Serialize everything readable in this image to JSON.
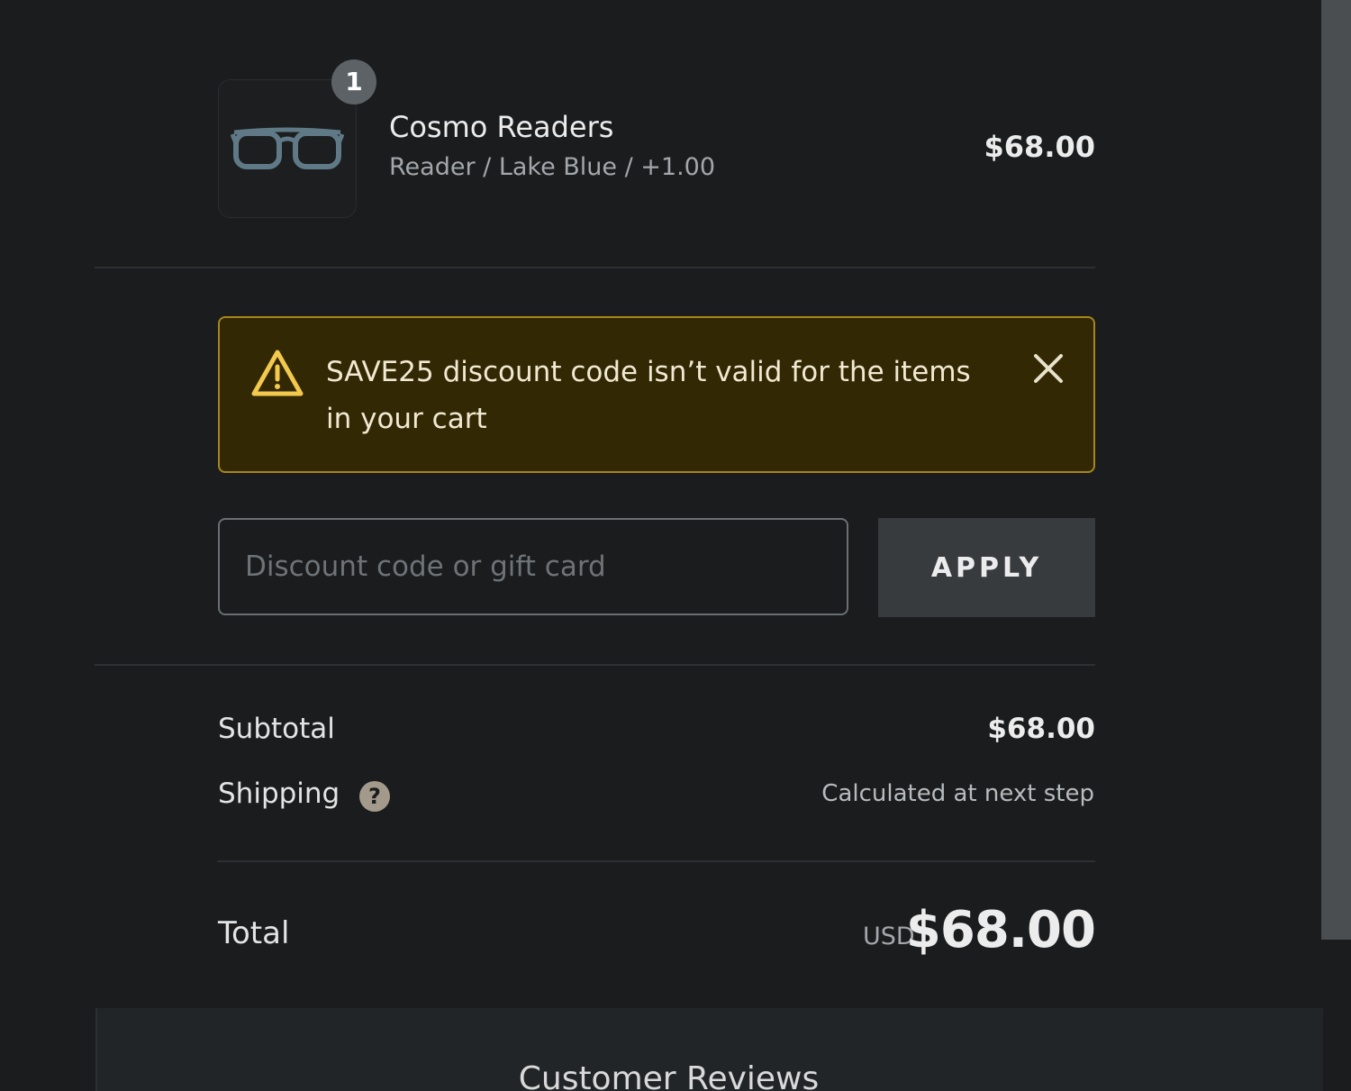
{
  "cart": {
    "item": {
      "quantity": "1",
      "name": "Cosmo Readers",
      "variant": "Reader / Lake Blue / +1.00",
      "price": "$68.00",
      "image_icon": "glasses-icon"
    }
  },
  "alert": {
    "message": "SAVE25 discount code isn’t valid for the items in your cart",
    "icon": "warning-icon",
    "close_icon": "close-icon"
  },
  "discount": {
    "placeholder": "Discount code or gift card",
    "value": "",
    "apply_label": "APPLY"
  },
  "summary": {
    "subtotal_label": "Subtotal",
    "subtotal_value": "$68.00",
    "shipping_label": "Shipping",
    "shipping_value": "Calculated at next step",
    "help_glyph": "?",
    "total_label": "Total",
    "currency": "USD",
    "total_value": "$68.00"
  },
  "reviews": {
    "title": "Customer Reviews"
  },
  "colors": {
    "background": "#1a1c1e",
    "banner_bg": "#322804",
    "banner_border": "#a7861a",
    "warning_icon": "#f2c94c"
  }
}
